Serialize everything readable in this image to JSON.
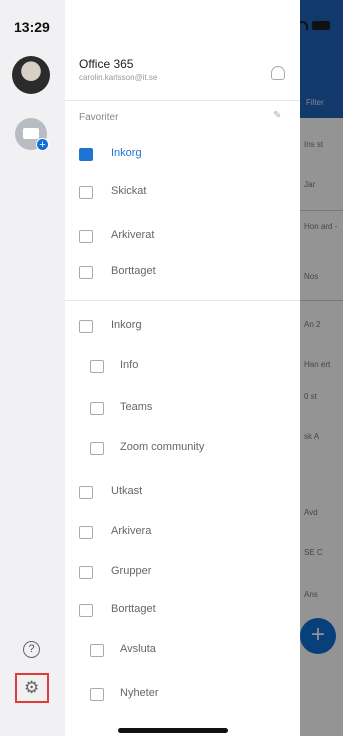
{
  "status_bar": {
    "time": "13:29"
  },
  "account": {
    "name": "Office 365",
    "email": "carolin.karlsson@it.se"
  },
  "folders_header": "Favoriter",
  "favorites": [
    {
      "label": "Inkorg",
      "icon": "inbox-icon",
      "active": true
    },
    {
      "label": "Skickat",
      "icon": "send-icon",
      "active": false
    },
    {
      "label": "Arkiverat",
      "icon": "archive-icon",
      "active": false
    },
    {
      "label": "Borttaget",
      "icon": "trash-icon",
      "active": false
    }
  ],
  "folders": [
    {
      "label": "Inkorg",
      "icon": "inbox-icon",
      "level": 0
    },
    {
      "label": "Info",
      "icon": "folder-icon",
      "level": 1
    },
    {
      "label": "Teams",
      "icon": "folder-icon",
      "level": 1
    },
    {
      "label": "Zoom community",
      "icon": "folder-icon",
      "level": 1
    },
    {
      "label": "Utkast",
      "icon": "draft-icon",
      "level": 0
    },
    {
      "label": "Arkivera",
      "icon": "archive-icon",
      "level": 0
    },
    {
      "label": "Grupper",
      "icon": "groups-icon",
      "level": 0
    },
    {
      "label": "Borttaget",
      "icon": "trash-icon",
      "level": 0
    },
    {
      "label": "Avsluta",
      "icon": "folder-icon",
      "level": 1
    },
    {
      "label": "Nyheter",
      "icon": "folder-icon",
      "level": 1
    }
  ],
  "background": {
    "header_button": "Filter",
    "snippets": [
      "Ins st",
      "Jar",
      "Hon ard -",
      "Nos",
      "An 2",
      "Han ert",
      "0 st",
      "sk A",
      "Avd",
      "SE C",
      "Ans"
    ]
  },
  "colors": {
    "accent": "#1f74d2",
    "header": "#1f62b9",
    "highlight_box": "#e23b3b"
  }
}
